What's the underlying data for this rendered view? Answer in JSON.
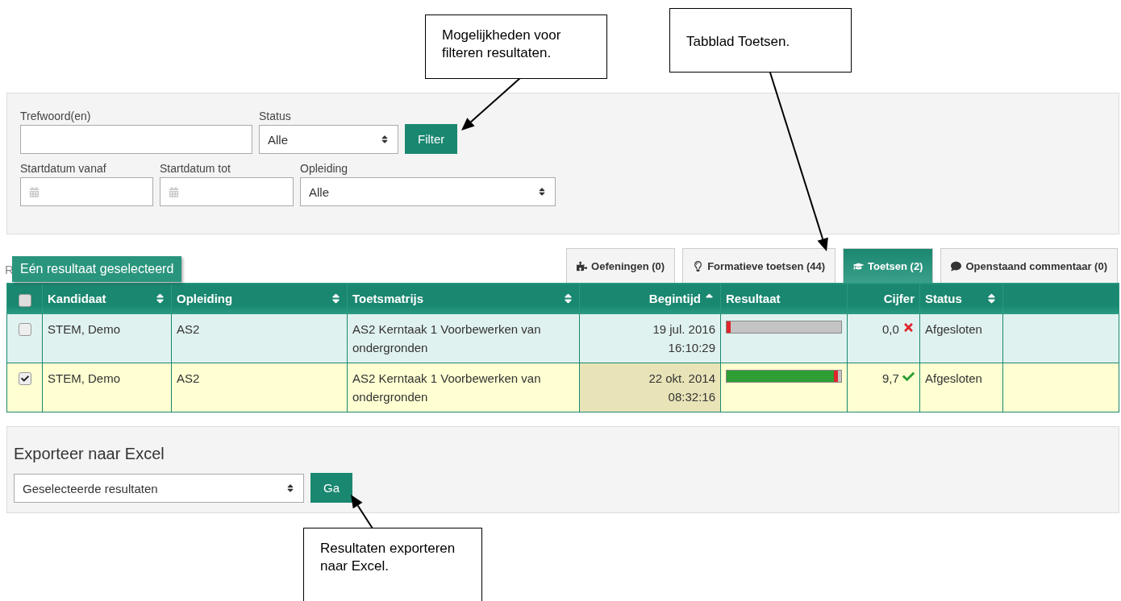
{
  "callouts": [
    {
      "text": "Mogelijkheden voor filteren resultaten."
    },
    {
      "text": "Tabblad Toetsen."
    },
    {
      "text": "Resultaten exporteren naar Excel."
    }
  ],
  "filter": {
    "keyword": {
      "label": "Trefwoord(en)"
    },
    "status": {
      "label": "Status",
      "value": "Alle"
    },
    "button": "Filter",
    "date_from": {
      "label": "Startdatum vanaf"
    },
    "date_to": {
      "label": "Startdatum tot"
    },
    "opleiding": {
      "label": "Opleiding",
      "value": "Alle"
    }
  },
  "results_label": "R",
  "tooltip": "Eén resultaat geselecteerd",
  "tabs": [
    {
      "label": "Oefeningen (0)",
      "kind": "puzzle",
      "selected": false
    },
    {
      "label": "Formatieve toetsen (44)",
      "kind": "bulb",
      "selected": false
    },
    {
      "label": "Toetsen (2)",
      "kind": "cap",
      "selected": true
    },
    {
      "label": "Openstaand commentaar (0)",
      "kind": "comment",
      "selected": false
    }
  ],
  "table": {
    "all_checked": false,
    "columns": [
      {
        "label": "Kandidaat",
        "kind": "sortable",
        "sorted": false
      },
      {
        "label": "Opleiding",
        "kind": "sortable",
        "sorted": false
      },
      {
        "label": "Toetsmatrijs",
        "kind": "sortable",
        "sorted": false
      },
      {
        "label": "Begintijd",
        "kind": "sortable",
        "sorted": true
      },
      {
        "label": "Resultaat",
        "kind": "plain"
      },
      {
        "label": "Cijfer",
        "kind": "plain"
      },
      {
        "label": "Status",
        "kind": "sortable",
        "sorted": false
      }
    ],
    "rows": [
      {
        "checked": false,
        "kandidaat": "STEM, Demo",
        "opleiding": "AS2",
        "toetsmatrijs": "AS2 Kerntaak 1 Voorbewerken van ondergronden",
        "date": "19 jul. 2016",
        "time": "16:10:29",
        "level": 0,
        "cijfer": "0,0",
        "passed": false,
        "status": "Afgesloten"
      },
      {
        "checked": true,
        "kandidaat": "STEM, Demo",
        "opleiding": "AS2",
        "toetsmatrijs": "AS2 Kerntaak 1 Voorbewerken van ondergronden",
        "date": "22 okt. 2014",
        "time": "08:32:16",
        "level": 0.97,
        "cijfer": "9,7",
        "passed": true,
        "status": "Afgesloten"
      }
    ]
  },
  "export": {
    "title": "Exporteer naar Excel",
    "value": "Geselecteerde resultaten",
    "button": "Ga"
  }
}
